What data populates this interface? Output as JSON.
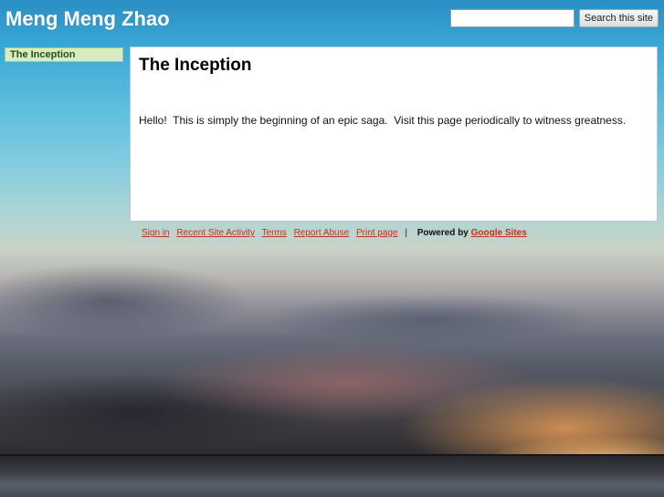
{
  "header": {
    "site_title": "Meng Meng Zhao",
    "search": {
      "value": "",
      "placeholder": "",
      "button_label": "Search this site"
    }
  },
  "sidebar": {
    "items": [
      {
        "label": "The Inception",
        "selected": true
      }
    ]
  },
  "main": {
    "page_title": "The Inception",
    "body_text": "Hello!  This is simply the beginning of an epic saga.  Visit this page periodically to witness greatness."
  },
  "footer": {
    "links": [
      "Sign in",
      "Recent Site Activity",
      "Terms",
      "Report Abuse",
      "Print page"
    ],
    "separator": "|",
    "powered_by_label": "Powered by",
    "powered_by_link": "Google Sites"
  },
  "colors": {
    "link": "#c0311d",
    "sidebar_selected_bg": "#d8ecc4",
    "sidebar_selected_text": "#26501a",
    "title_text": "#ffffff"
  }
}
